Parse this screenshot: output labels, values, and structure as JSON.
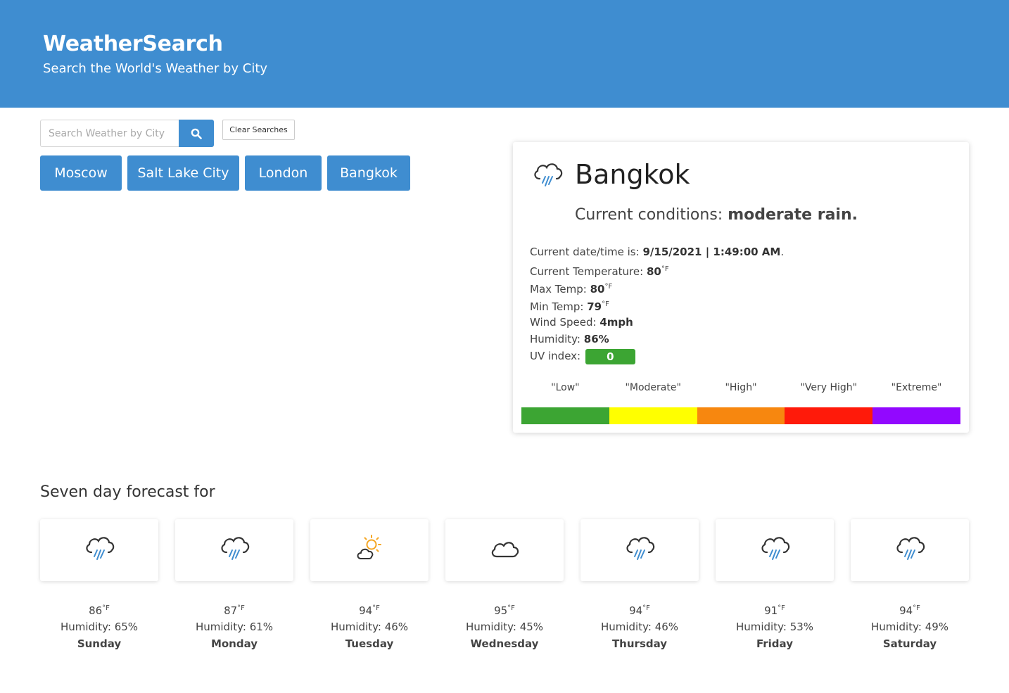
{
  "header": {
    "title": "WeatherSearch",
    "subtitle": "Search the World's Weather by City",
    "bg_color": "#3f8dd0"
  },
  "search": {
    "placeholder": "Search Weather by City",
    "value": "",
    "button_icon": "search-icon",
    "clear_label": "Clear Searches"
  },
  "history": [
    "Moscow",
    "Salt Lake City",
    "London",
    "Bangkok"
  ],
  "current": {
    "icon": "rain-cloud-icon",
    "city": "Bangkok",
    "conditions_label": "Current conditions:",
    "conditions_value": "moderate rain.",
    "datetime_label": "Current date/time is:",
    "datetime_value": "9/15/2021 | 1:49:00 AM",
    "datetime_suffix": ".",
    "temp_label": "Current Temperature:",
    "temp_value": "80",
    "max_label": "Max Temp:",
    "max_value": "80",
    "min_label": "Min Temp:",
    "min_value": "79",
    "unit": "°F",
    "wind_label": "Wind Speed:",
    "wind_value": "4mph",
    "humidity_label": "Humidity:",
    "humidity_value": "86%",
    "uv_label": "UV index:",
    "uv_value": "0",
    "uv_color": "#3ca533"
  },
  "uv_scale": [
    {
      "label": "\"Low\"",
      "color": "#3ca533"
    },
    {
      "label": "\"Moderate\"",
      "color": "#ffff00"
    },
    {
      "label": "\"High\"",
      "color": "#f7870f"
    },
    {
      "label": "\"Very High\"",
      "color": "#ff1a0a"
    },
    {
      "label": "\"Extreme\"",
      "color": "#9208ff"
    }
  ],
  "forecast": {
    "title": "Seven day forecast for",
    "days": [
      {
        "day": "Sunday",
        "temp": "86",
        "unit": "°F",
        "humidity": "Humidity: 65%",
        "icon": "rain-cloud-icon"
      },
      {
        "day": "Monday",
        "temp": "87",
        "unit": "°F",
        "humidity": "Humidity: 61%",
        "icon": "rain-cloud-icon"
      },
      {
        "day": "Tuesday",
        "temp": "94",
        "unit": "°F",
        "humidity": "Humidity: 46%",
        "icon": "partly-sunny-icon"
      },
      {
        "day": "Wednesday",
        "temp": "95",
        "unit": "°F",
        "humidity": "Humidity: 45%",
        "icon": "cloud-icon"
      },
      {
        "day": "Thursday",
        "temp": "94",
        "unit": "°F",
        "humidity": "Humidity: 46%",
        "icon": "rain-cloud-icon"
      },
      {
        "day": "Friday",
        "temp": "91",
        "unit": "°F",
        "humidity": "Humidity: 53%",
        "icon": "rain-cloud-icon"
      },
      {
        "day": "Saturday",
        "temp": "94",
        "unit": "°F",
        "humidity": "Humidity: 49%",
        "icon": "rain-cloud-icon"
      }
    ]
  }
}
